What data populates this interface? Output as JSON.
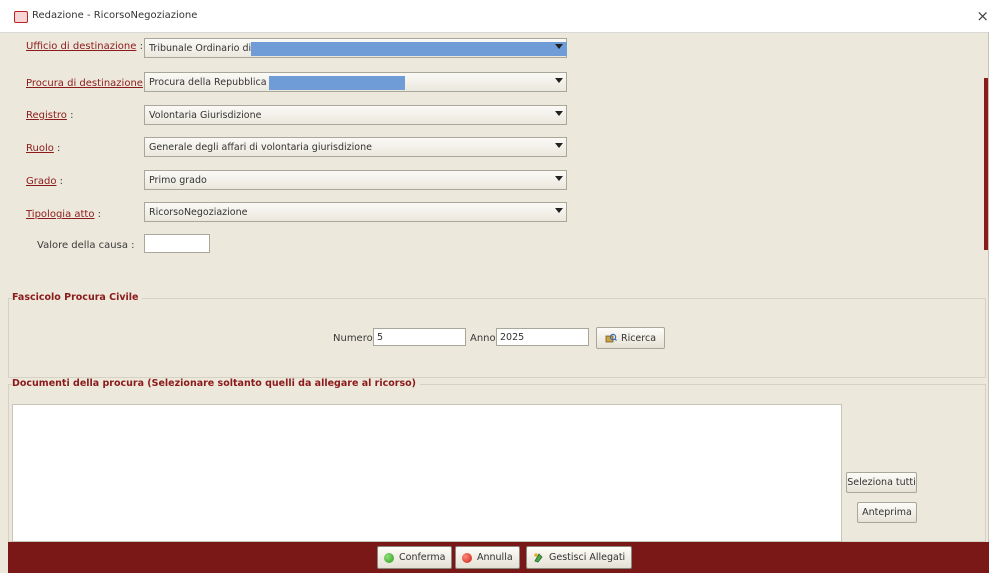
{
  "window": {
    "title": "Redazione - RicorsoNegoziazione",
    "close_glyph": "×"
  },
  "form": {
    "fields": [
      {
        "label": "Ufficio di destinazione",
        "value": "Tribunale Ordinario di"
      },
      {
        "label": "Procura di destinazione",
        "value": "Procura della Repubblica di"
      },
      {
        "label": "Registro",
        "value": "Volontaria Giurisdizione"
      },
      {
        "label": "Ruolo",
        "value": "Generale degli affari di volontaria giurisdizione"
      },
      {
        "label": "Grado",
        "value": "Primo grado"
      },
      {
        "label": "Tipologia atto",
        "value": "RicorsoNegoziazione"
      }
    ],
    "valore_label": "Valore della causa :",
    "valore_value": "",
    "label_suffix": " :"
  },
  "fascicolo": {
    "legend": "Fascicolo Procura Civile",
    "numero_label": "Numero",
    "numero_value": "5",
    "anno_label": "Anno",
    "anno_value": "2025",
    "ricerca_label": "Ricerca"
  },
  "documenti": {
    "legend": "Documenti della procura (Selezionare soltanto quelli da allegare al ricorso)",
    "seleziona_label": "Seleziona tutti",
    "anteprima_label": "Anteprima"
  },
  "footer": {
    "conferma_label": "Conferma",
    "annulla_label": "Annulla",
    "allegati_label": "Gestisci Allegati"
  },
  "colors": {
    "accent": "#8b1a1a",
    "footer_bg": "#7a1717",
    "panel_bg": "#ece8dc",
    "redaction": "#6f9bd6"
  },
  "icons": {
    "title": "window-app-icon",
    "close": "close-icon",
    "ricerca": "search-icon",
    "conferma": "confirm-icon",
    "annulla": "cancel-icon",
    "allegati": "attachments-icon"
  }
}
